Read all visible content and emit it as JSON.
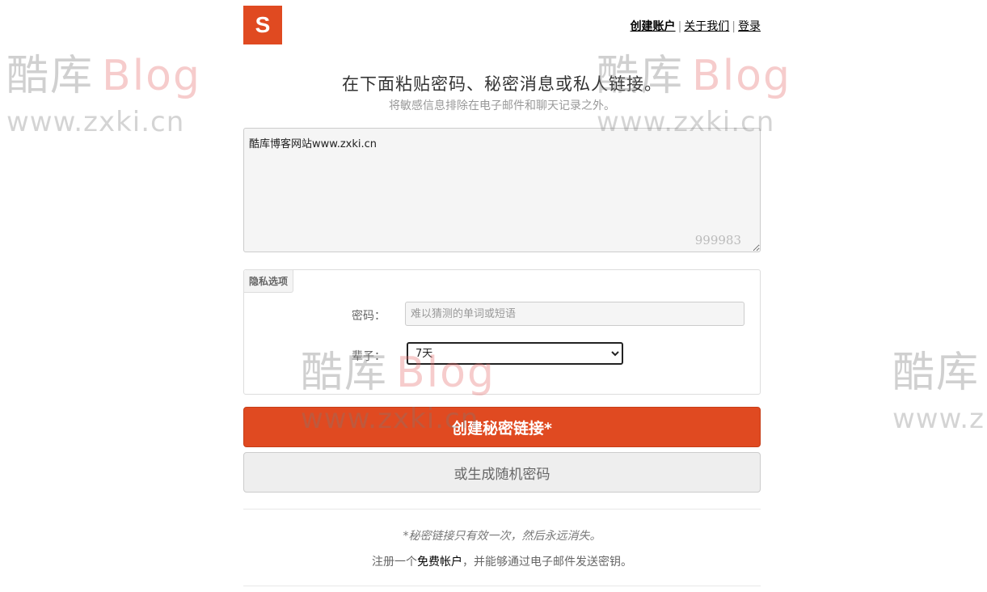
{
  "logo": {
    "letter": "S"
  },
  "nav": {
    "create_account": "创建账户",
    "about_us": "关于我们",
    "sign_in": "登录",
    "separator": "|"
  },
  "headline": "在下面粘贴密码、秘密消息或私人链接。",
  "subline": "将敏感信息排除在电子邮件和聊天记录之外。",
  "secret": {
    "value": "酷库博客网站www.zxki.cn",
    "char_count": "999983"
  },
  "privacy": {
    "legend": "隐私选项",
    "passphrase_label": "密码：",
    "passphrase_placeholder": "难以猜测的单词或短语",
    "ttl_label": "辈子：",
    "ttl_selected": "7天"
  },
  "buttons": {
    "create": "创建秘密链接*",
    "generate": "或生成随机密码"
  },
  "footer": {
    "note": "*秘密链接只有效一次，然后永远消失。",
    "signup_before": "注册一个",
    "signup_link": "免费帐户",
    "signup_after": "，并能够通过电子邮件发送密钥。"
  },
  "watermark": {
    "cn": "酷库",
    "latin": "Blog",
    "url": "www.zxki.cn",
    "url_cut": "www.z"
  }
}
